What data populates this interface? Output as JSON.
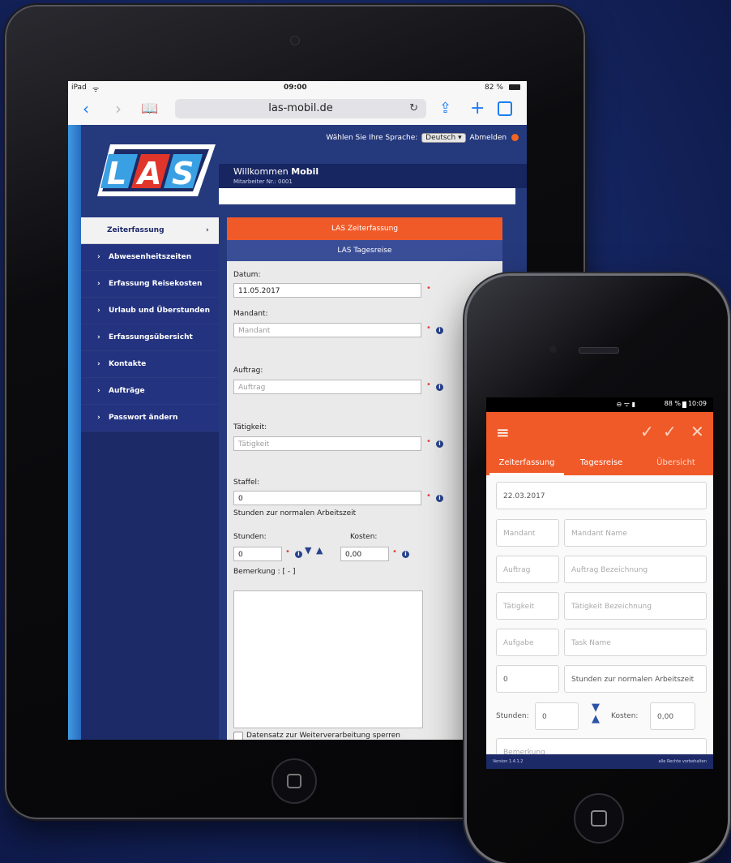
{
  "colors": {
    "accent": "#f05a28",
    "brand_blue": "#25397d",
    "nav_blue": "#1d2a68",
    "link_blue": "#1e7cf2"
  },
  "tablet": {
    "status_bar": {
      "device": "iPad",
      "time": "09:00",
      "battery": "82 %"
    },
    "browser": {
      "url": "las-mobil.de"
    },
    "header": {
      "language_label": "Wählen Sie Ihre Sprache:",
      "language_value": "Deutsch",
      "logout_label": "Abmelden",
      "logo_text": "LAS",
      "welcome_prefix": "Willkommen ",
      "welcome_name": "Mobil",
      "employee_no": "Mitarbeiter Nr.: 0001"
    },
    "nav": [
      {
        "label": "Zeiterfassung"
      },
      {
        "label": "Abwesenheitszeiten"
      },
      {
        "label": "Erfassung Reisekosten"
      },
      {
        "label": "Urlaub und Überstunden"
      },
      {
        "label": "Erfassungsübersicht"
      },
      {
        "label": "Kontakte"
      },
      {
        "label": "Aufträge"
      },
      {
        "label": "Passwort ändern"
      }
    ],
    "form": {
      "header_primary": "LAS Zeiterfassung",
      "header_secondary": "LAS Tagesreise",
      "date_label": "Datum:",
      "date_value": "11.05.2017",
      "client_label": "Mandant:",
      "client_placeholder": "Mandant",
      "order_label": "Auftrag:",
      "order_placeholder": "Auftrag",
      "activity_label": "Tätigkeit:",
      "activity_placeholder": "Tätigkeit",
      "scale_label": "Staffel:",
      "scale_value": "0",
      "scale_hint": "Stunden zur normalen Arbeitszeit",
      "hours_label": "Stunden:",
      "hours_value": "0",
      "cost_label": "Kosten:",
      "cost_value": "0,00",
      "remark_label": "Bemerkung : [ - ]",
      "lock_label": "Datensatz zur Weiterverarbeitung sperren"
    }
  },
  "phone": {
    "status_bar": {
      "battery": "88 %",
      "time": "10:09"
    },
    "tabs": [
      {
        "label": "Zeiterfassung"
      },
      {
        "label": "Tagesreise"
      },
      {
        "label": "Übersicht"
      }
    ],
    "fields": {
      "date_value": "22.03.2017",
      "client_placeholder": "Mandant",
      "client_name_placeholder": "Mandant Name",
      "order_placeholder": "Auftrag",
      "order_desc_placeholder": "Auftrag Bezeichnung",
      "activity_placeholder": "Tätigkeit",
      "activity_desc_placeholder": "Tätigkeit Bezeichnung",
      "task_placeholder": "Aufgabe",
      "task_name_placeholder": "Task Name",
      "scale_value": "0",
      "scale_hint": "Stunden zur normalen Arbeitszeit",
      "hours_label": "Stunden:",
      "hours_value": "0",
      "cost_label": "Kosten:",
      "cost_value": "0,00",
      "remark_placeholder": "Bemerkung"
    },
    "footer": {
      "version": "Version 1.4.1.2",
      "rights": "alle Rechte vorbehalten"
    }
  }
}
